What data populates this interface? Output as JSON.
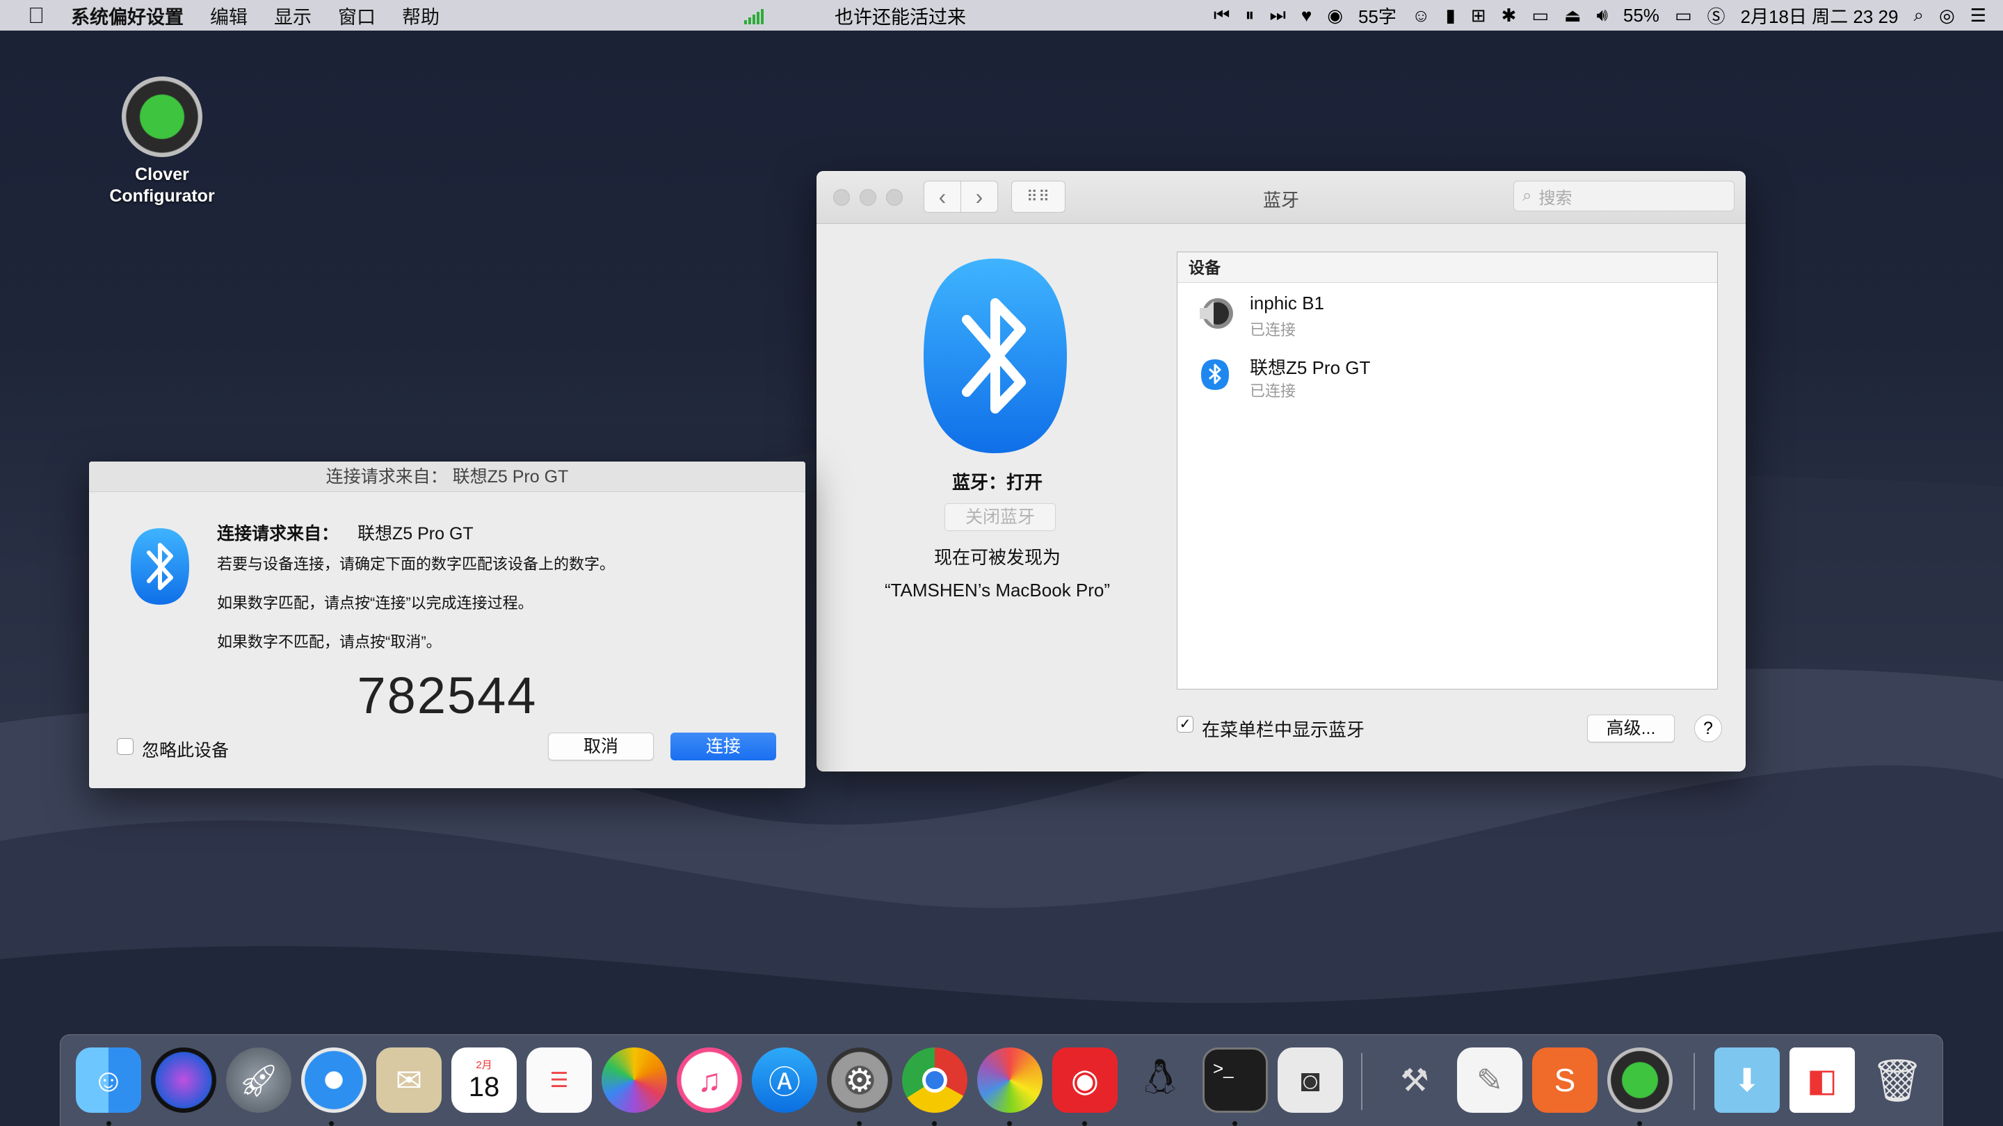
{
  "menubar": {
    "apple": "",
    "app": "系统偏好设置",
    "menus": [
      "编辑",
      "显示",
      "窗口",
      "帮助"
    ],
    "now_playing": "也许还能活过来",
    "temp": "55字",
    "battery": "55%",
    "datetime": "2月18日 周二 23 29"
  },
  "desktop": {
    "icon_label_1": "Clover",
    "icon_label_2": "Configurator"
  },
  "bluetooth_window": {
    "title": "蓝牙",
    "search_placeholder": "搜索",
    "status": "蓝牙：打开",
    "turn_off_btn": "关闭蓝牙",
    "discoverable": "现在可被发现为",
    "computer_name": "“TAMSHEN’s MacBook Pro”",
    "devices_header": "设备",
    "devices": [
      {
        "name": "inphic B1",
        "status": "已连接",
        "icon": "speaker-icon"
      },
      {
        "name": "联想Z5 Pro GT",
        "status": "已连接",
        "icon": "bluetooth-icon"
      }
    ],
    "show_in_menubar": "在菜单栏中显示蓝牙",
    "show_in_menubar_checked": true,
    "advanced_btn": "高级...",
    "help": "?"
  },
  "pair_dialog": {
    "title": "连接请求来自： 联想Z5 Pro GT",
    "heading_label": "连接请求来自：",
    "heading_device": "联想Z5 Pro GT",
    "line1": "若要与设备连接，请确定下面的数字匹配该设备上的数字。",
    "line2": "如果数字匹配，请点按“连接”以完成连接过程。",
    "line3": "如果数字不匹配，请点按“取消”。",
    "code": "782544",
    "ignore_label": "忽略此设备",
    "cancel_btn": "取消",
    "connect_btn": "连接"
  },
  "dock": {
    "calendar_month": "2月",
    "calendar_day": "18",
    "apps": [
      "finder-icon",
      "siri-icon",
      "launchpad-icon",
      "safari-icon",
      "mail-icon",
      "calendar-icon",
      "reminders-icon",
      "photos-icon",
      "itunes-icon",
      "app-store-icon",
      "system-preferences-icon",
      "chrome-icon",
      "pinwheel-icon",
      "netease-music-icon",
      "qq-icon",
      "terminal-icon",
      "screenshot-icon",
      "utility-icon",
      "textedit-icon",
      "sogou-icon",
      "clover-icon",
      "downloads-icon",
      "screenshots-folder-icon",
      "trash-icon"
    ]
  }
}
